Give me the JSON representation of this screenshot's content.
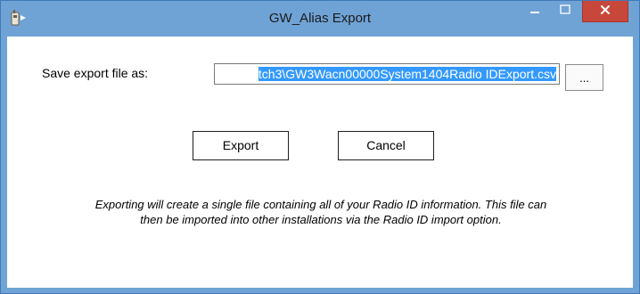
{
  "window": {
    "title": "GW_Alias Export",
    "close_color": "#c7473b",
    "frame_color": "#6fa3d6"
  },
  "form": {
    "save_label": "Save export file as:",
    "path_value": "tch3\\GW3Wacn00000System1404Radio IDExport.csv",
    "browse_label": "..."
  },
  "buttons": {
    "export_label": "Export",
    "cancel_label": "Cancel"
  },
  "info": {
    "text": "Exporting will create a single file containing all of your Radio ID information.  This file can then be imported into other installations via the Radio ID import option."
  },
  "icons": {
    "app": "radio-app-icon",
    "minimize": "minimize-icon",
    "maximize": "maximize-icon",
    "close": "close-icon"
  }
}
